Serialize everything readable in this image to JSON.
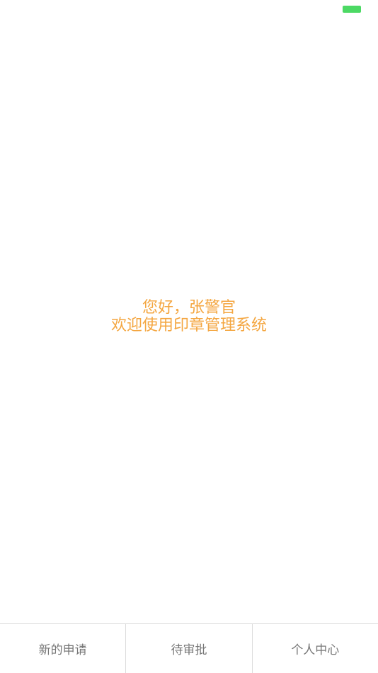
{
  "status_bar": {
    "battery_icon": "battery-icon",
    "battery_color": "#4cd964"
  },
  "welcome": {
    "greeting": "您好，张警官",
    "message": "欢迎使用印章管理系统",
    "color": "#f4a640"
  },
  "tab_bar": {
    "tabs": [
      {
        "label": "新的申请"
      },
      {
        "label": "待审批"
      },
      {
        "label": "个人中心"
      }
    ]
  }
}
